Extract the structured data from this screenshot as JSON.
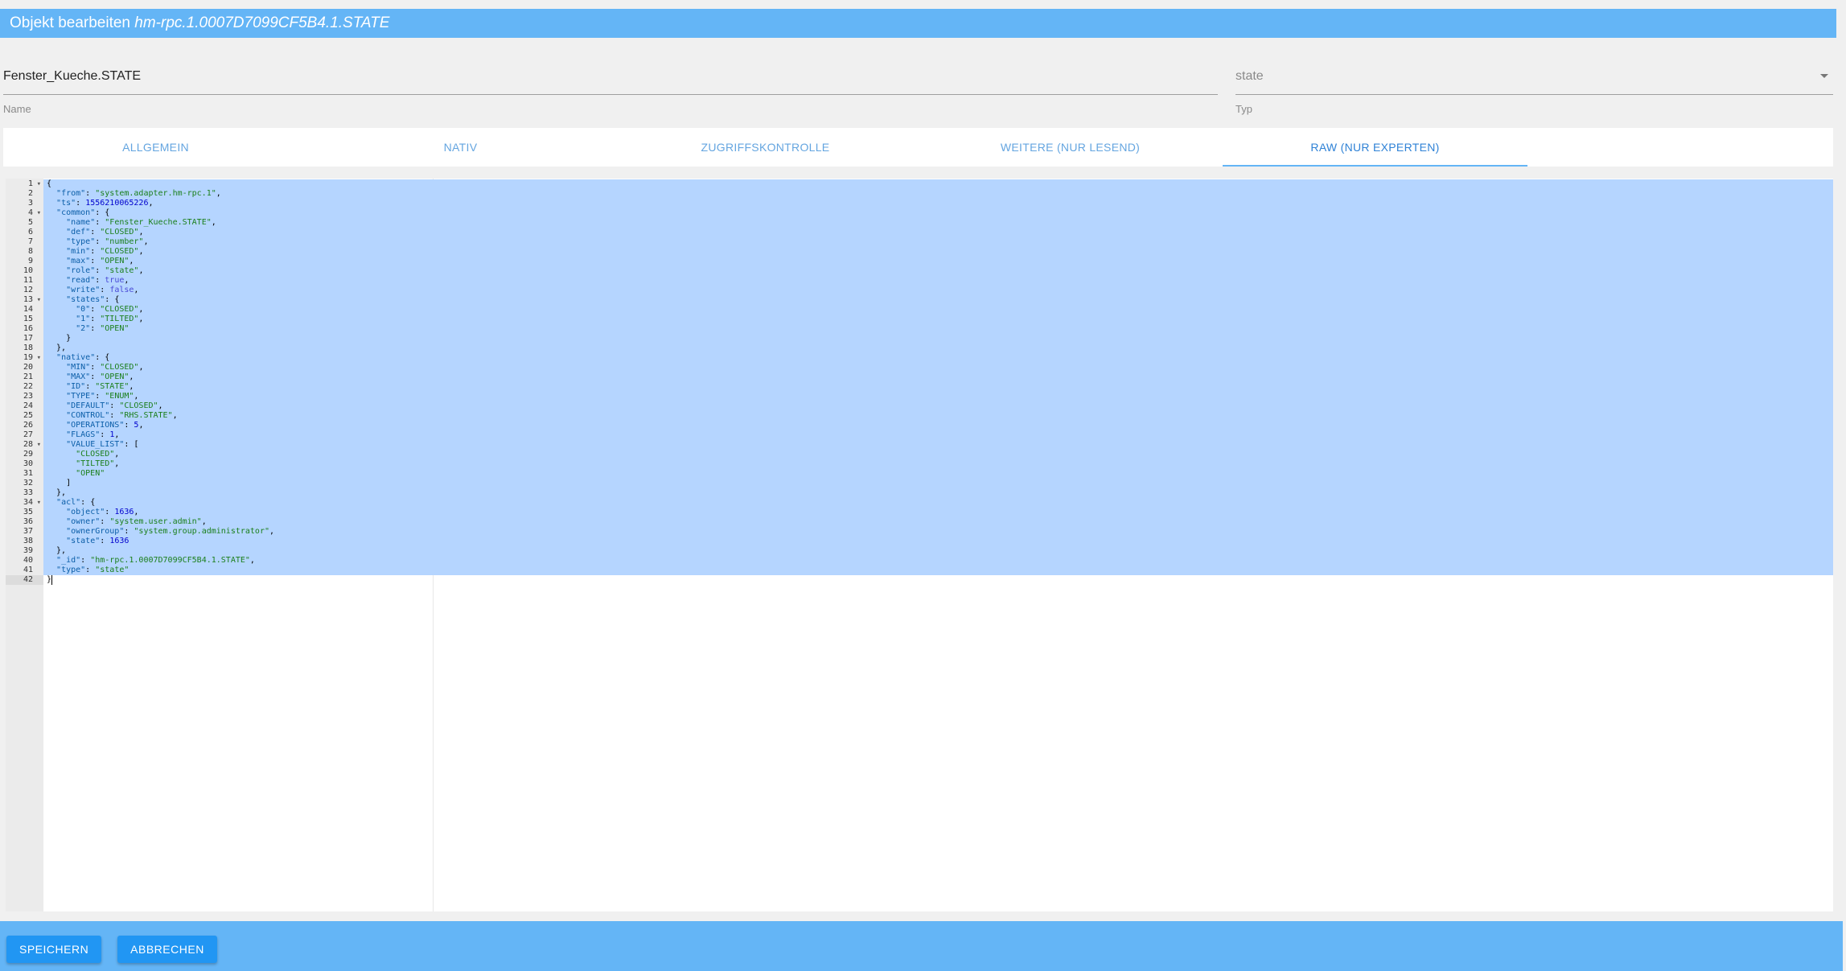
{
  "dialog": {
    "title_prefix": "Objekt bearbeiten",
    "object_id": "hm-rpc.1.0007D7099CF5B4.1.STATE"
  },
  "fields": {
    "name": {
      "value": "Fenster_Kueche.STATE",
      "label": "Name"
    },
    "type": {
      "value": "state",
      "label": "Typ"
    }
  },
  "tabs": [
    {
      "label": "ALLGEMEIN"
    },
    {
      "label": "NATIV"
    },
    {
      "label": "ZUGRIFFSKONTROLLE"
    },
    {
      "label": "WEITERE (NUR LESEND)"
    },
    {
      "label": "RAW (NUR EXPERTEN)"
    }
  ],
  "active_tab": 4,
  "editor": {
    "fold_lines": [
      1,
      4,
      13,
      19,
      28,
      34
    ],
    "lines": [
      "{",
      "  \"from\": \"system.adapter.hm-rpc.1\",",
      "  \"ts\": 1556210065226,",
      "  \"common\": {",
      "    \"name\": \"Fenster_Kueche.STATE\",",
      "    \"def\": \"CLOSED\",",
      "    \"type\": \"number\",",
      "    \"min\": \"CLOSED\",",
      "    \"max\": \"OPEN\",",
      "    \"role\": \"state\",",
      "    \"read\": true,",
      "    \"write\": false,",
      "    \"states\": {",
      "      \"0\": \"CLOSED\",",
      "      \"1\": \"TILTED\",",
      "      \"2\": \"OPEN\"",
      "    }",
      "  },",
      "  \"native\": {",
      "    \"MIN\": \"CLOSED\",",
      "    \"MAX\": \"OPEN\",",
      "    \"ID\": \"STATE\",",
      "    \"TYPE\": \"ENUM\",",
      "    \"DEFAULT\": \"CLOSED\",",
      "    \"CONTROL\": \"RHS.STATE\",",
      "    \"OPERATIONS\": 5,",
      "    \"FLAGS\": 1,",
      "    \"VALUE_LIST\": [",
      "      \"CLOSED\",",
      "      \"TILTED\",",
      "      \"OPEN\"",
      "    ]",
      "  },",
      "  \"acl\": {",
      "    \"object\": 1636,",
      "    \"owner\": \"system.user.admin\",",
      "    \"ownerGroup\": \"system.group.administrator\",",
      "    \"state\": 1636",
      "  },",
      "  \"_id\": \"hm-rpc.1.0007D7099CF5B4.1.STATE\",",
      "  \"type\": \"state\"",
      "}"
    ]
  },
  "buttons": {
    "save": "SPEICHERN",
    "cancel": "ABBRECHEN"
  },
  "colors": {
    "accent": "#64b5f6",
    "button": "#2196f3",
    "selection": "#b5d5ff"
  }
}
